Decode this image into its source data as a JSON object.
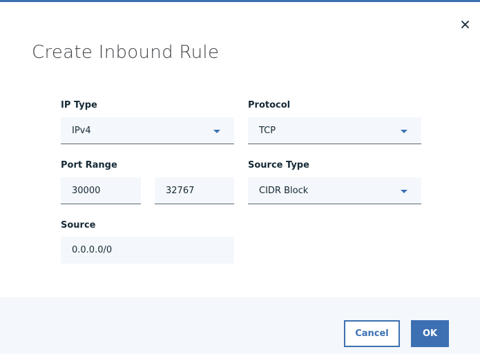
{
  "dialog": {
    "title": "Create Inbound Rule",
    "close_icon": "close-icon"
  },
  "form": {
    "ip_type": {
      "label": "IP Type",
      "value": "IPv4"
    },
    "protocol": {
      "label": "Protocol",
      "value": "TCP"
    },
    "port_range": {
      "label": "Port Range",
      "from": "30000",
      "to": "32767"
    },
    "source_type": {
      "label": "Source Type",
      "value": "CIDR Block"
    },
    "source": {
      "label": "Source",
      "value": "0.0.0.0/0"
    }
  },
  "footer": {
    "cancel_label": "Cancel",
    "ok_label": "OK"
  },
  "colors": {
    "accent": "#3d70b2",
    "field_bg": "#f4f7fb",
    "text": "#152935"
  }
}
